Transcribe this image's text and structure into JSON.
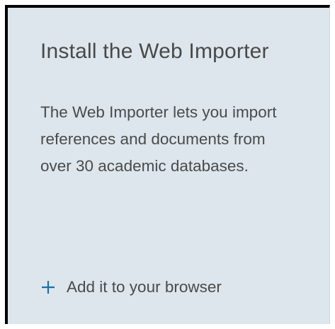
{
  "card": {
    "title": "Install the Web Importer",
    "description": "The Web Importer lets you import references and documents from over 30 academic databases.",
    "action": {
      "icon": "plus-icon",
      "label": "Add it to your browser"
    }
  },
  "colors": {
    "card_background": "#dde6ed",
    "text": "#4a4a4a",
    "accent": "#1f6ea6",
    "frame": "#000000"
  }
}
